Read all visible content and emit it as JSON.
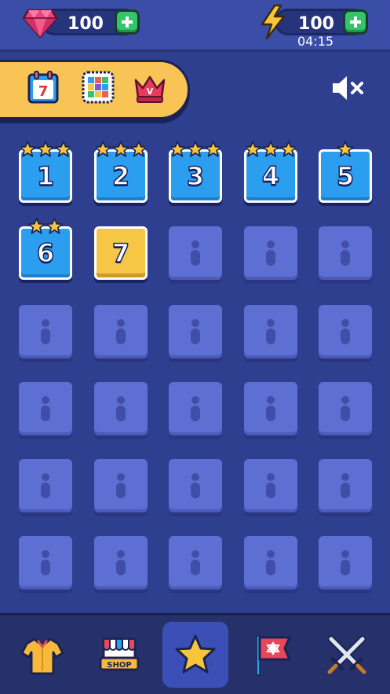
{
  "resources": {
    "gems": "100",
    "energy": "100",
    "energy_timer": "04:15"
  },
  "mode_bar": {
    "items": [
      {
        "icon": "calendar-icon",
        "label": "7"
      },
      {
        "icon": "grid-board-icon"
      },
      {
        "icon": "crown-icon",
        "label": "V"
      }
    ]
  },
  "sound": {
    "icon": "mute-icon",
    "state": "muted"
  },
  "levels": [
    {
      "number": "1",
      "state": "completed",
      "stars": 3
    },
    {
      "number": "2",
      "state": "completed",
      "stars": 3
    },
    {
      "number": "3",
      "state": "completed",
      "stars": 3
    },
    {
      "number": "4",
      "state": "completed",
      "stars": 3
    },
    {
      "number": "5",
      "state": "completed",
      "stars": 1
    },
    {
      "number": "6",
      "state": "completed",
      "stars": 2
    },
    {
      "number": "7",
      "state": "current",
      "stars": 0
    },
    {
      "state": "locked"
    },
    {
      "state": "locked"
    },
    {
      "state": "locked"
    },
    {
      "state": "locked"
    },
    {
      "state": "locked"
    },
    {
      "state": "locked"
    },
    {
      "state": "locked"
    },
    {
      "state": "locked"
    },
    {
      "state": "locked"
    },
    {
      "state": "locked"
    },
    {
      "state": "locked"
    },
    {
      "state": "locked"
    },
    {
      "state": "locked"
    },
    {
      "state": "locked"
    },
    {
      "state": "locked"
    },
    {
      "state": "locked"
    },
    {
      "state": "locked"
    },
    {
      "state": "locked"
    },
    {
      "state": "locked"
    },
    {
      "state": "locked"
    },
    {
      "state": "locked"
    },
    {
      "state": "locked"
    },
    {
      "state": "locked"
    }
  ],
  "bottom_nav": [
    {
      "icon": "shirt-icon",
      "active": false
    },
    {
      "icon": "shop-icon",
      "label": "SHOP",
      "active": false
    },
    {
      "icon": "star-icon",
      "active": true
    },
    {
      "icon": "flag-icon",
      "active": false
    },
    {
      "icon": "crossed-swords-icon",
      "active": false
    }
  ],
  "colors": {
    "background": "#2e3f8f",
    "level_completed": "#2b9ef0",
    "level_current": "#f6c744",
    "level_locked": "#5d6fd2",
    "accent_green": "#34c46a",
    "mode_bar": "#f8c456"
  }
}
